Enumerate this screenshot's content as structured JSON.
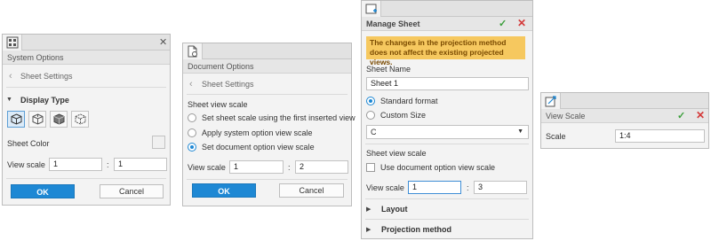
{
  "system_options": {
    "title": "System Options",
    "section": "Sheet Settings",
    "display_type_label": "Display Type",
    "sheet_color_label": "Sheet Color",
    "view_scale_label": "View scale",
    "view_scale_num": "1",
    "colon": ":",
    "view_scale_den": "1",
    "ok": "OK",
    "cancel": "Cancel",
    "close": "✕"
  },
  "document_options": {
    "title": "Document Options",
    "section": "Sheet Settings",
    "group_label": "Sheet view scale",
    "radio_first_view": "Set sheet scale using the first inserted view",
    "radio_system": "Apply system option view scale",
    "radio_document": "Set document option view scale",
    "view_scale_label": "View scale",
    "view_scale_num": "1",
    "colon": ":",
    "view_scale_den": "2",
    "ok": "OK",
    "cancel": "Cancel"
  },
  "manage_sheet": {
    "title": "Manage Sheet",
    "notice": "The changes in the projection method does not affect the existing projected views.",
    "sheet_name_label": "Sheet Name",
    "sheet_name_value": "Sheet 1",
    "radio_standard": "Standard format",
    "radio_custom": "Custom Size",
    "size_value": "C",
    "sheet_view_scale_label": "Sheet view scale",
    "use_doc_option": "Use document option view scale",
    "view_scale_label": "View scale",
    "view_scale_num": "1",
    "colon": ":",
    "view_scale_den": "3",
    "layout_label": "Layout",
    "projection_label": "Projection method",
    "confirm": "✓",
    "cancel": "✕"
  },
  "view_scale": {
    "title": "View Scale",
    "scale_label": "Scale",
    "scale_value": "1:4",
    "confirm": "✓",
    "cancel": "✕"
  },
  "colors": {
    "accent": "#1e88d4",
    "notice_bg": "#f6c85f",
    "confirm_green": "#3b9f3b",
    "cancel_red": "#d43a3a"
  }
}
